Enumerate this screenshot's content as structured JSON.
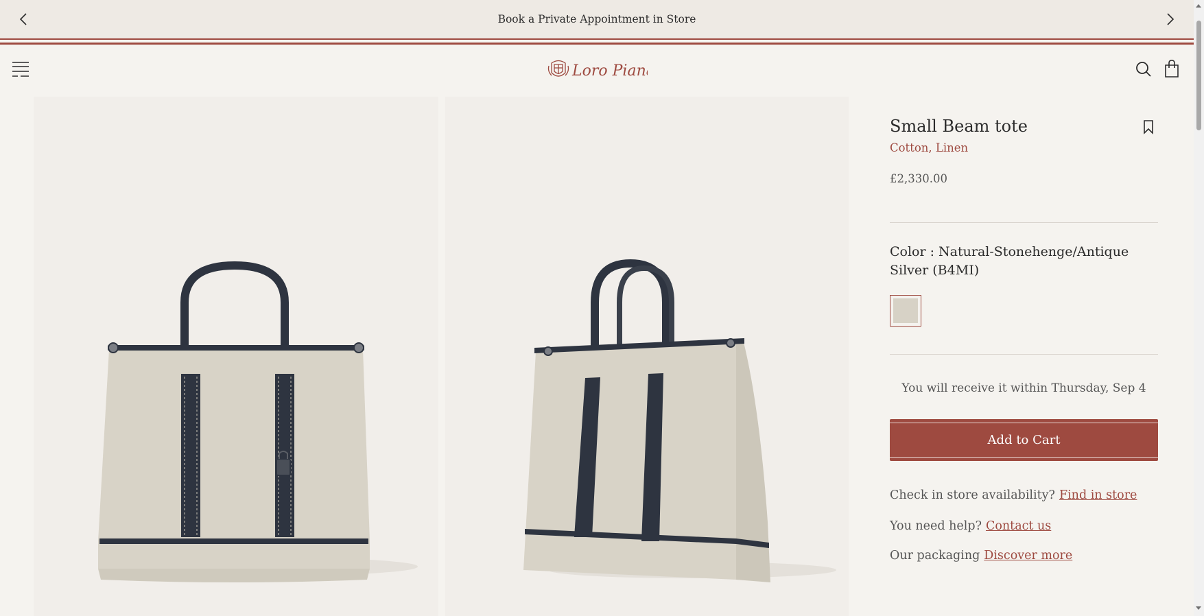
{
  "announcement": {
    "text": "Book a Private Appointment in Store",
    "prev_icon": "chevron-left-icon",
    "next_icon": "chevron-right-icon"
  },
  "header": {
    "logo_text": "Loro Piana",
    "menu_icon": "hamburger-menu-icon",
    "search_icon": "search-icon",
    "bag_icon": "shopping-bag-icon"
  },
  "product": {
    "title": "Small Beam tote",
    "material": "Cotton, Linen",
    "price": "£2,330.00",
    "color_label": "Color : Natural-Stonehenge/Antique Silver (B4MI)",
    "swatch_color": "#d7d2c6",
    "delivery": "You will receive it within Thursday, Sep 4",
    "add_to_cart": "Add to Cart"
  },
  "links": {
    "store_prompt": "Check in store availability?",
    "store_link": "Find in store",
    "help_prompt": "You need help?",
    "help_link": "Contact us",
    "packaging_prompt": "Our packaging",
    "packaging_link": "Discover more"
  },
  "colors": {
    "accent": "#9e4a40",
    "background": "#f5f3ef",
    "announce_bg": "#eeeae4",
    "canvas": "#d8d3c7",
    "leather": "#2e3440"
  }
}
